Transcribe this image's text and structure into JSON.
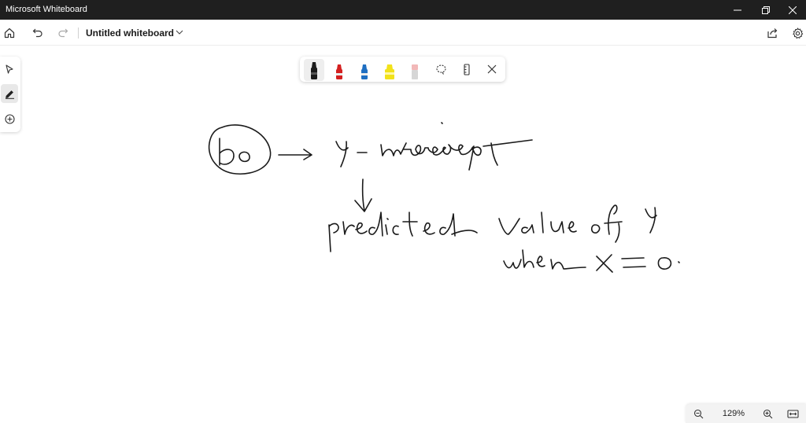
{
  "window": {
    "app_title": "Microsoft Whiteboard"
  },
  "toolbar": {
    "board_title": "Untitled whiteboard"
  },
  "pen_tray": {
    "pens": [
      {
        "name": "black-pen",
        "color": "#1a1a1a",
        "active": true
      },
      {
        "name": "red-pen",
        "color": "#d42020",
        "active": false
      },
      {
        "name": "blue-pen",
        "color": "#1f6fc2",
        "active": false
      },
      {
        "name": "yellow-highlighter",
        "color": "#f2e21a",
        "active": false
      },
      {
        "name": "eraser",
        "color": "#f2b8b8",
        "active": false
      }
    ]
  },
  "ink": {
    "color": "#1a1a1a",
    "handwriting": [
      "bo",
      "→",
      "Y-intercept",
      "↓",
      "predicted value of Y",
      "when X = 0."
    ]
  },
  "zoom": {
    "level": "129%"
  }
}
